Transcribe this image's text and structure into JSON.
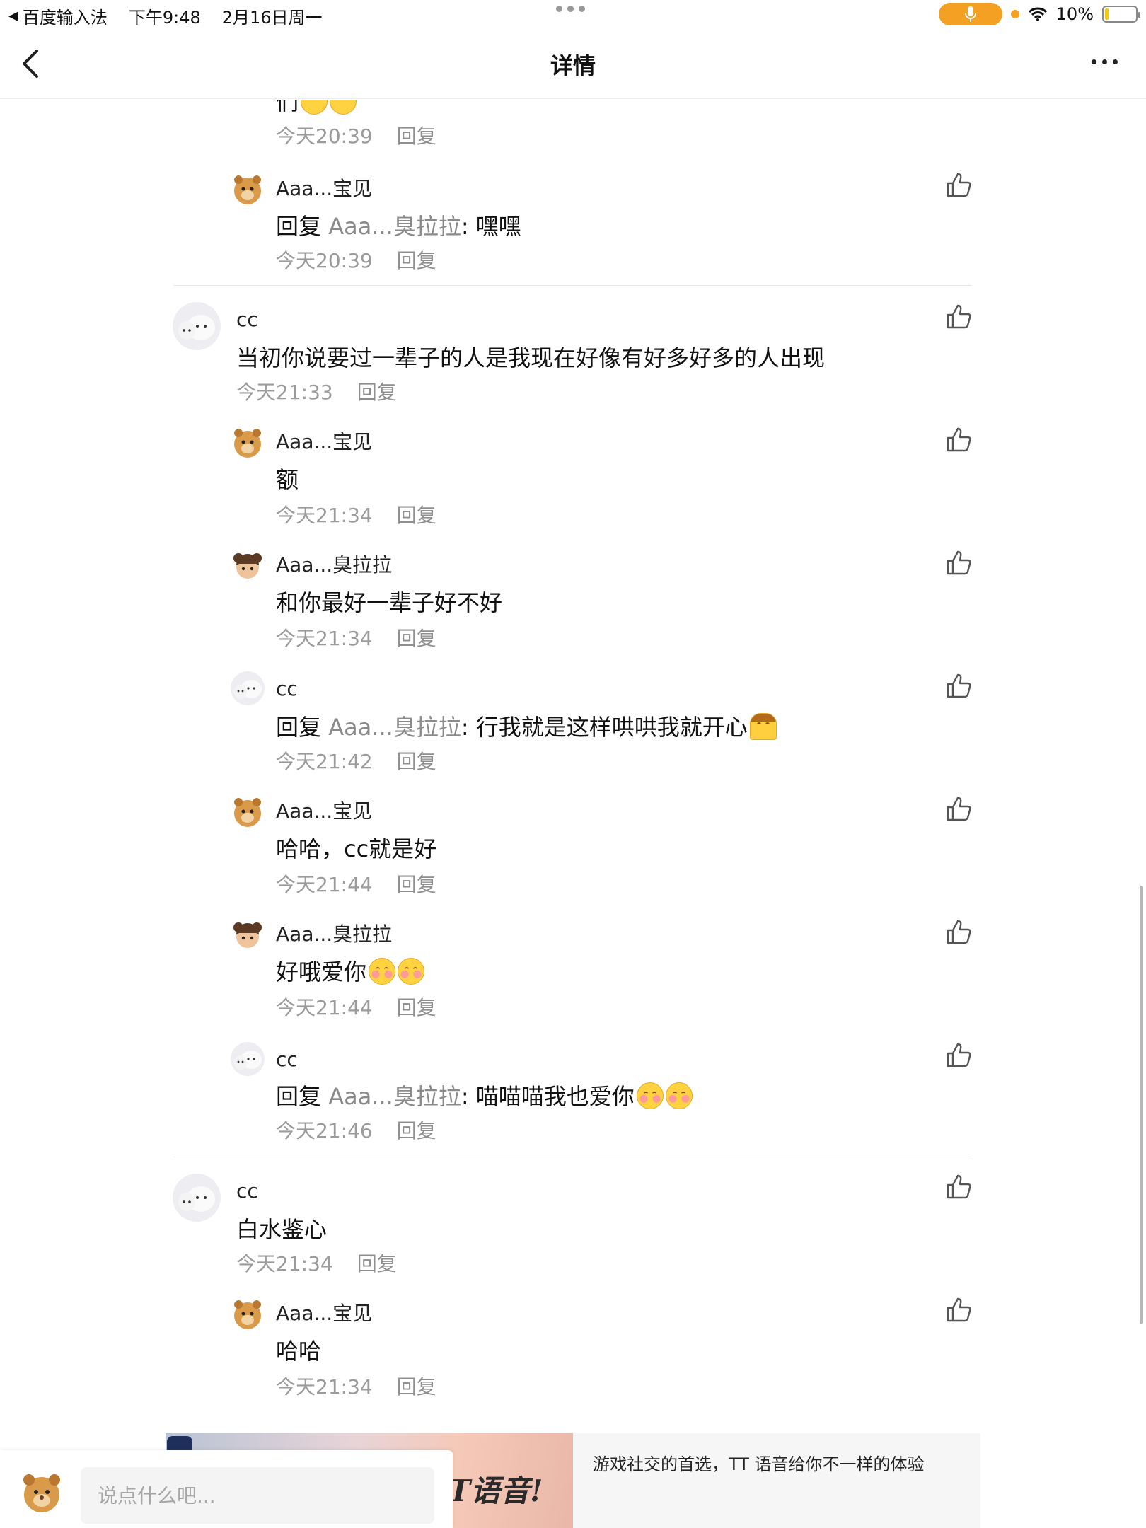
{
  "status_bar": {
    "back_app": "百度输入法",
    "time": "下午9:48",
    "date": "2月16日周一",
    "battery": "10%"
  },
  "nav": {
    "title": "详情"
  },
  "comments": {
    "top_time": "今天20:39",
    "c1": {
      "name": "Aaa...宝见",
      "prefix": "回复 ",
      "reply_to": "Aaa...臭拉拉",
      "text": ": 嘿嘿",
      "time": "今天20:39"
    },
    "c2": {
      "name": "cc",
      "text": "当初你说要过一辈子的人是我现在好像有好多好多的人出现",
      "time": "今天21:33"
    },
    "c3": {
      "name": "Aaa...宝见",
      "text": "额",
      "time": "今天21:34"
    },
    "c4": {
      "name": "Aaa...臭拉拉",
      "text": "和你最好一辈子好不好",
      "time": "今天21:34"
    },
    "c5": {
      "name": "cc",
      "prefix": "回复 ",
      "reply_to": "Aaa...臭拉拉",
      "text": ": 行我就是这样哄哄我就开心",
      "time": "今天21:42"
    },
    "c6": {
      "name": "Aaa...宝见",
      "text": "哈哈，cc就是好",
      "time": "今天21:44"
    },
    "c7": {
      "name": "Aaa...臭拉拉",
      "text": "好哦爱你",
      "time": "今天21:44"
    },
    "c8": {
      "name": "cc",
      "prefix": "回复 ",
      "reply_to": "Aaa...臭拉拉",
      "text": ": 喵喵喵我也爱你",
      "time": "今天21:46"
    },
    "c9": {
      "name": "cc",
      "text": "白水鉴心",
      "time": "今天21:34"
    },
    "c10": {
      "name": "Aaa...宝见",
      "text": "哈哈",
      "time": "今天21:34"
    },
    "reply_label": "回复"
  },
  "ad": {
    "text": "游戏社交的首选，TT 语音给你不一样的体验",
    "image_caption": "TT语音!"
  },
  "input": {
    "placeholder": "说点什么吧..."
  },
  "colors": {
    "accent": "#f3a023",
    "meta_gray": "#9b9b9b",
    "divider": "#e6e6e6"
  },
  "icons": [
    "back-arrow-icon",
    "more-icon",
    "like-icon",
    "microphone-icon",
    "wifi-icon",
    "battery-icon"
  ]
}
